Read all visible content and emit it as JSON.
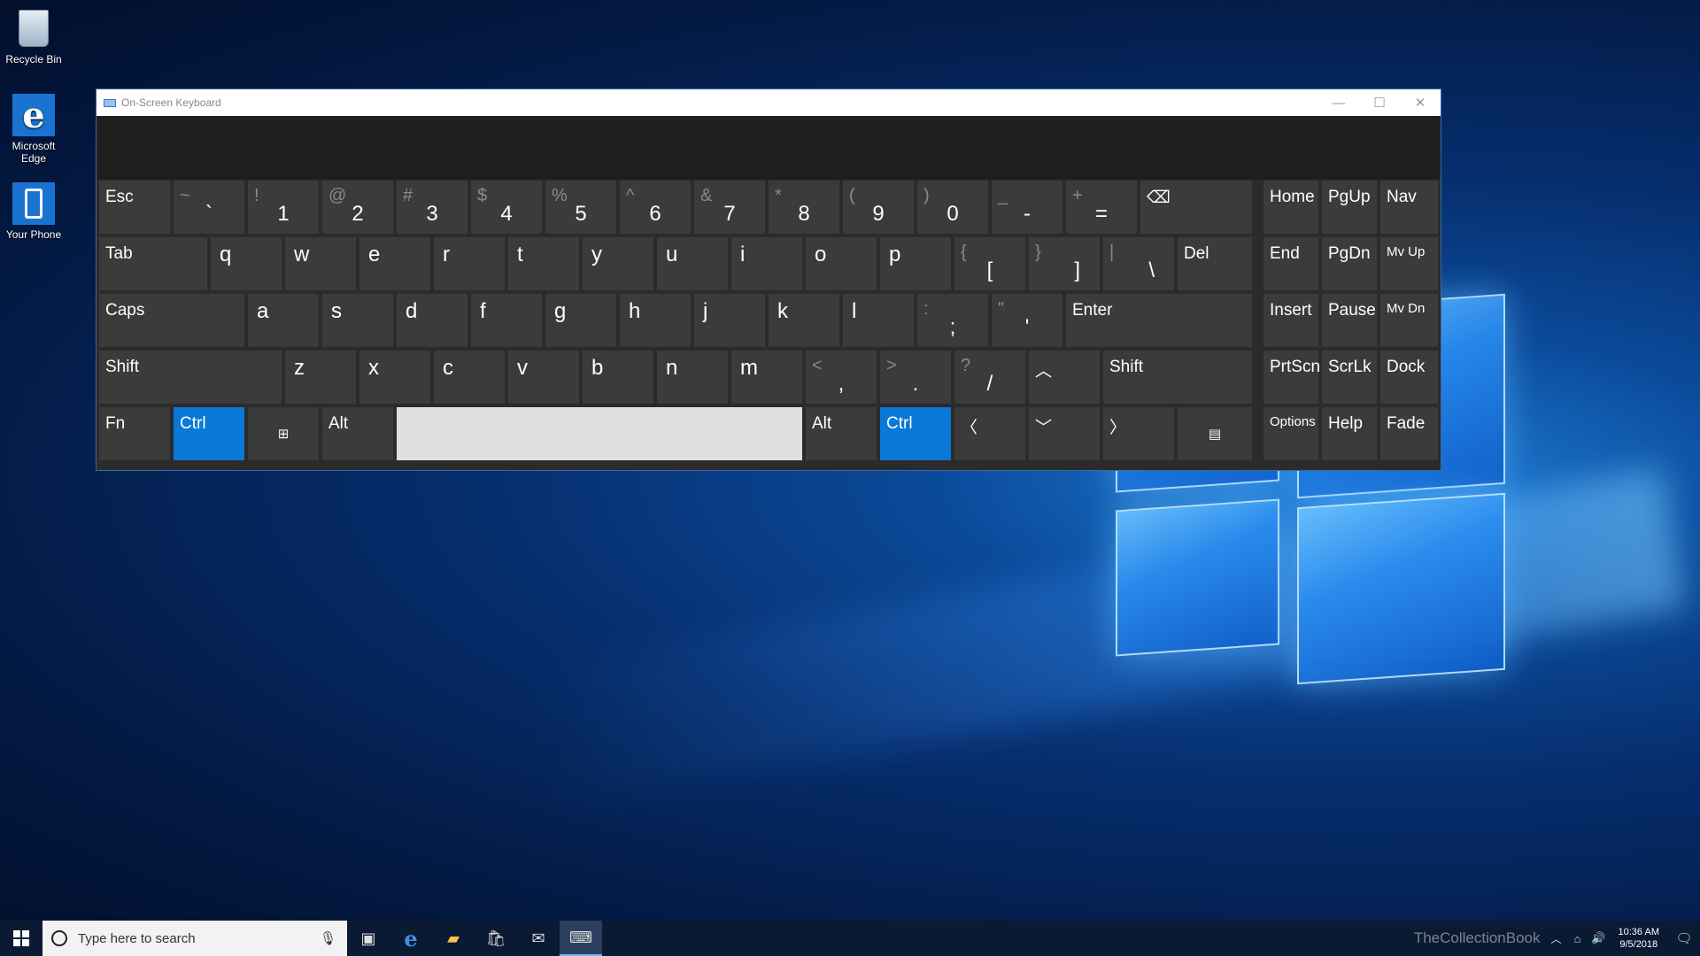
{
  "desktop": {
    "icons": [
      {
        "label": "Recycle Bin"
      },
      {
        "label": "Microsoft Edge"
      },
      {
        "label": "Your Phone"
      }
    ]
  },
  "window": {
    "title": "On-Screen Keyboard",
    "controls": {
      "minimize": "—",
      "maximize": "☐",
      "close": "✕"
    }
  },
  "keyboard": {
    "row1": {
      "esc": "Esc",
      "backtick": {
        "sym": "~",
        "main": "`"
      },
      "k1": {
        "sym": "!",
        "main": "1"
      },
      "k2": {
        "sym": "@",
        "main": "2"
      },
      "k3": {
        "sym": "#",
        "main": "3"
      },
      "k4": {
        "sym": "$",
        "main": "4"
      },
      "k5": {
        "sym": "%",
        "main": "5"
      },
      "k6": {
        "sym": "^",
        "main": "6"
      },
      "k7": {
        "sym": "&",
        "main": "7"
      },
      "k8": {
        "sym": "*",
        "main": "8"
      },
      "k9": {
        "sym": "(",
        "main": "9"
      },
      "k0": {
        "sym": ")",
        "main": "0"
      },
      "minus": {
        "sym": "_",
        "main": "-"
      },
      "equals": {
        "sym": "+",
        "main": "="
      },
      "backspace": "⌫"
    },
    "row2": {
      "tab": "Tab",
      "letters": [
        "q",
        "w",
        "e",
        "r",
        "t",
        "y",
        "u",
        "i",
        "o",
        "p"
      ],
      "lbracket": {
        "sym": "{",
        "main": "["
      },
      "rbracket": {
        "sym": "}",
        "main": "]"
      },
      "backslash": {
        "sym": "|",
        "main": "\\"
      },
      "del": "Del"
    },
    "row3": {
      "caps": "Caps",
      "letters": [
        "a",
        "s",
        "d",
        "f",
        "g",
        "h",
        "j",
        "k",
        "l"
      ],
      "semicolon": {
        "sym": ":",
        "main": ";"
      },
      "quote": {
        "sym": "\"",
        "main": "'"
      },
      "enter": "Enter"
    },
    "row4": {
      "shift_left": "Shift",
      "letters": [
        "z",
        "x",
        "c",
        "v",
        "b",
        "n",
        "m"
      ],
      "comma": {
        "sym": "<",
        "main": ","
      },
      "period": {
        "sym": ">",
        "main": "."
      },
      "slash": {
        "sym": "?",
        "main": "/"
      },
      "up": "︿",
      "shift_right": "Shift"
    },
    "row5": {
      "fn": "Fn",
      "ctrl_left": "Ctrl",
      "win": "⊞",
      "alt_left": "Alt",
      "alt_right": "Alt",
      "ctrl_right": "Ctrl",
      "left": "〈",
      "down": "﹀",
      "right": "〉",
      "menu": "▤"
    },
    "nav": {
      "home": "Home",
      "pgup": "PgUp",
      "nav": "Nav",
      "end": "End",
      "pgdn": "PgDn",
      "mvup": "Mv Up",
      "insert": "Insert",
      "pause": "Pause",
      "mvdn": "Mv Dn",
      "prtscn": "PrtScn",
      "scrlk": "ScrLk",
      "dock": "Dock",
      "options": "Options",
      "help": "Help",
      "fade": "Fade"
    },
    "colors": {
      "key": "#3b3b3b",
      "active": "#0a78d7",
      "space": "#e0e0e0"
    }
  },
  "taskbar": {
    "search_placeholder": "Type here to search",
    "icons": [
      "start-icon",
      "microphone-icon",
      "task-view-icon",
      "edge-icon",
      "file-explorer-icon",
      "store-icon",
      "mail-icon",
      "osk-icon"
    ],
    "watermark": "TheCollectionBook",
    "time": "10:36 AM",
    "date": "9/5/2018"
  }
}
